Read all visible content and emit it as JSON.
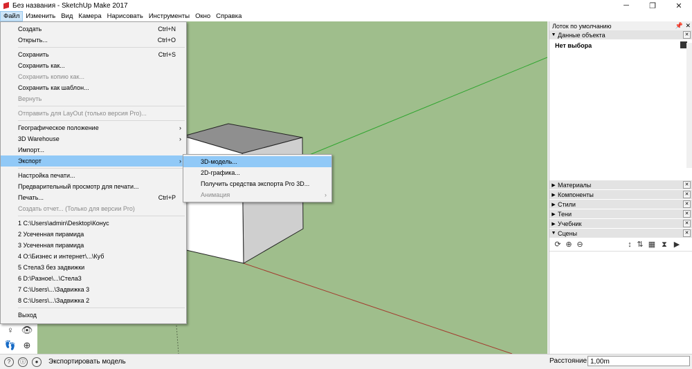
{
  "window": {
    "title": "Без названия - SketchUp Make 2017",
    "minimize": "─",
    "restore": "❐",
    "close": "✕"
  },
  "menubar": [
    {
      "label": "Файл",
      "active": true
    },
    {
      "label": "Изменить"
    },
    {
      "label": "Вид"
    },
    {
      "label": "Камера"
    },
    {
      "label": "Нарисовать"
    },
    {
      "label": "Инструменты"
    },
    {
      "label": "Окно"
    },
    {
      "label": "Справка"
    }
  ],
  "file_menu": {
    "items": [
      {
        "label": "Создать",
        "shortcut": "Ctrl+N"
      },
      {
        "label": "Открыть...",
        "shortcut": "Ctrl+O"
      },
      {
        "label": "Сохранить",
        "shortcut": "Ctrl+S"
      },
      {
        "label": "Сохранить как..."
      },
      {
        "label": "Сохранить копию как...",
        "disabled": true
      },
      {
        "label": "Сохранить как шаблон..."
      },
      {
        "label": "Вернуть",
        "disabled": true
      },
      {
        "label": "Отправить для LayOut (только версия Pro)...",
        "disabled": true
      },
      {
        "label": "Географическое положение",
        "arrow": "›"
      },
      {
        "label": "3D Warehouse",
        "arrow": "›"
      },
      {
        "label": "Импорт..."
      },
      {
        "label": "Экспорт",
        "arrow": "›",
        "highlighted": true
      },
      {
        "label": "Настройка печати..."
      },
      {
        "label": "Предварительный просмотр для печати..."
      },
      {
        "label": "Печать...",
        "shortcut": "Ctrl+P"
      },
      {
        "label": "Создать отчет... (Только для версии Pro)",
        "disabled": true
      },
      {
        "label": "1 C:\\Users\\admin\\Desktop\\Конус"
      },
      {
        "label": "2 Усеченная пирамида"
      },
      {
        "label": "3 Усеченная пирамида"
      },
      {
        "label": "4 O:\\Бизнес и интернет\\...\\Куб"
      },
      {
        "label": "5 Стела3 без задвижки"
      },
      {
        "label": "6 D:\\Разное\\...\\Стела3"
      },
      {
        "label": "7 C:\\Users\\...\\Задвижка 3"
      },
      {
        "label": "8 C:\\Users\\...\\Задвижка 2"
      },
      {
        "label": "Выход"
      }
    ]
  },
  "export_submenu": {
    "items": [
      {
        "label": "3D-модель...",
        "highlighted": true
      },
      {
        "label": "2D-графика..."
      },
      {
        "label": "Получить средства экспорта Pro 3D..."
      },
      {
        "label": "Анимация",
        "disabled": true,
        "arrow": "›"
      }
    ]
  },
  "tray": {
    "title": "Лоток по умолчанию",
    "entity_panel": {
      "label": "Данные объекта",
      "value": "Нет выбора"
    },
    "panels": [
      {
        "label": "Материалы",
        "expanded": false
      },
      {
        "label": "Компоненты",
        "expanded": false
      },
      {
        "label": "Стили",
        "expanded": false
      },
      {
        "label": "Тени",
        "expanded": false
      },
      {
        "label": "Учебник",
        "expanded": false
      },
      {
        "label": "Сцены",
        "expanded": true
      }
    ]
  },
  "statusbar": {
    "message": "Экспортировать модель",
    "measure_label": "Расстояние",
    "measure_value": "1,00m"
  },
  "colors": {
    "viewport_bg": "#9fbe8c",
    "menu_highlight": "#91c9f7",
    "green_axis": "#2fa52f",
    "red_axis": "#a33b2e"
  }
}
